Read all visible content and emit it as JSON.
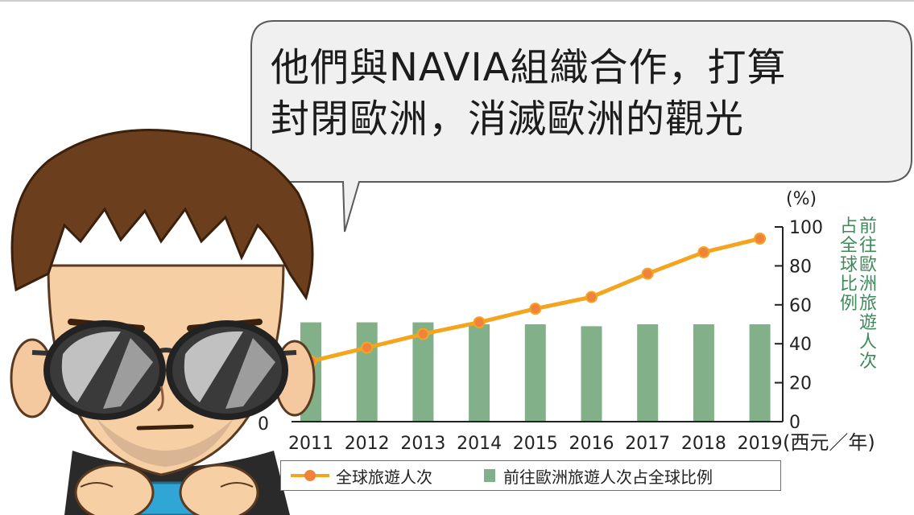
{
  "speech_bubble": {
    "lines": [
      "他們與NAVIA組織合作，打算",
      "封閉歐洲，消滅歐洲的觀光"
    ]
  },
  "colors": {
    "line": "#f3a520",
    "marker": "#f0823c",
    "bar": "#82b088",
    "right_axis_label": "#3f8a5a",
    "axis": "#222222"
  },
  "icons": [
    "sunglasses-cartoon-man-avatar"
  ],
  "chart_data": {
    "type": "bar",
    "title": "",
    "categories": [
      "2011",
      "2012",
      "2013",
      "2014",
      "2015",
      "2016",
      "2017",
      "2018",
      "2019"
    ],
    "x_unit_label": "(西元／年)",
    "y_unit_label": "(%)",
    "right_axis_title": "前往歐洲旅遊人次占全球比例",
    "ylim": [
      0,
      100
    ],
    "yticks": [
      0,
      20,
      40,
      60,
      80,
      100
    ],
    "series": [
      {
        "name": "全球旅遊人次",
        "type": "line",
        "values": [
          31,
          38,
          45,
          51,
          58,
          64,
          76,
          87,
          94
        ]
      },
      {
        "name": "前往歐洲旅遊人次占全球比例",
        "type": "bar",
        "values": [
          51,
          51,
          51,
          50,
          50,
          49,
          50,
          50,
          50
        ]
      }
    ],
    "legend_position": "bottom",
    "grid": false,
    "left_axis_visible_tick": "0"
  }
}
